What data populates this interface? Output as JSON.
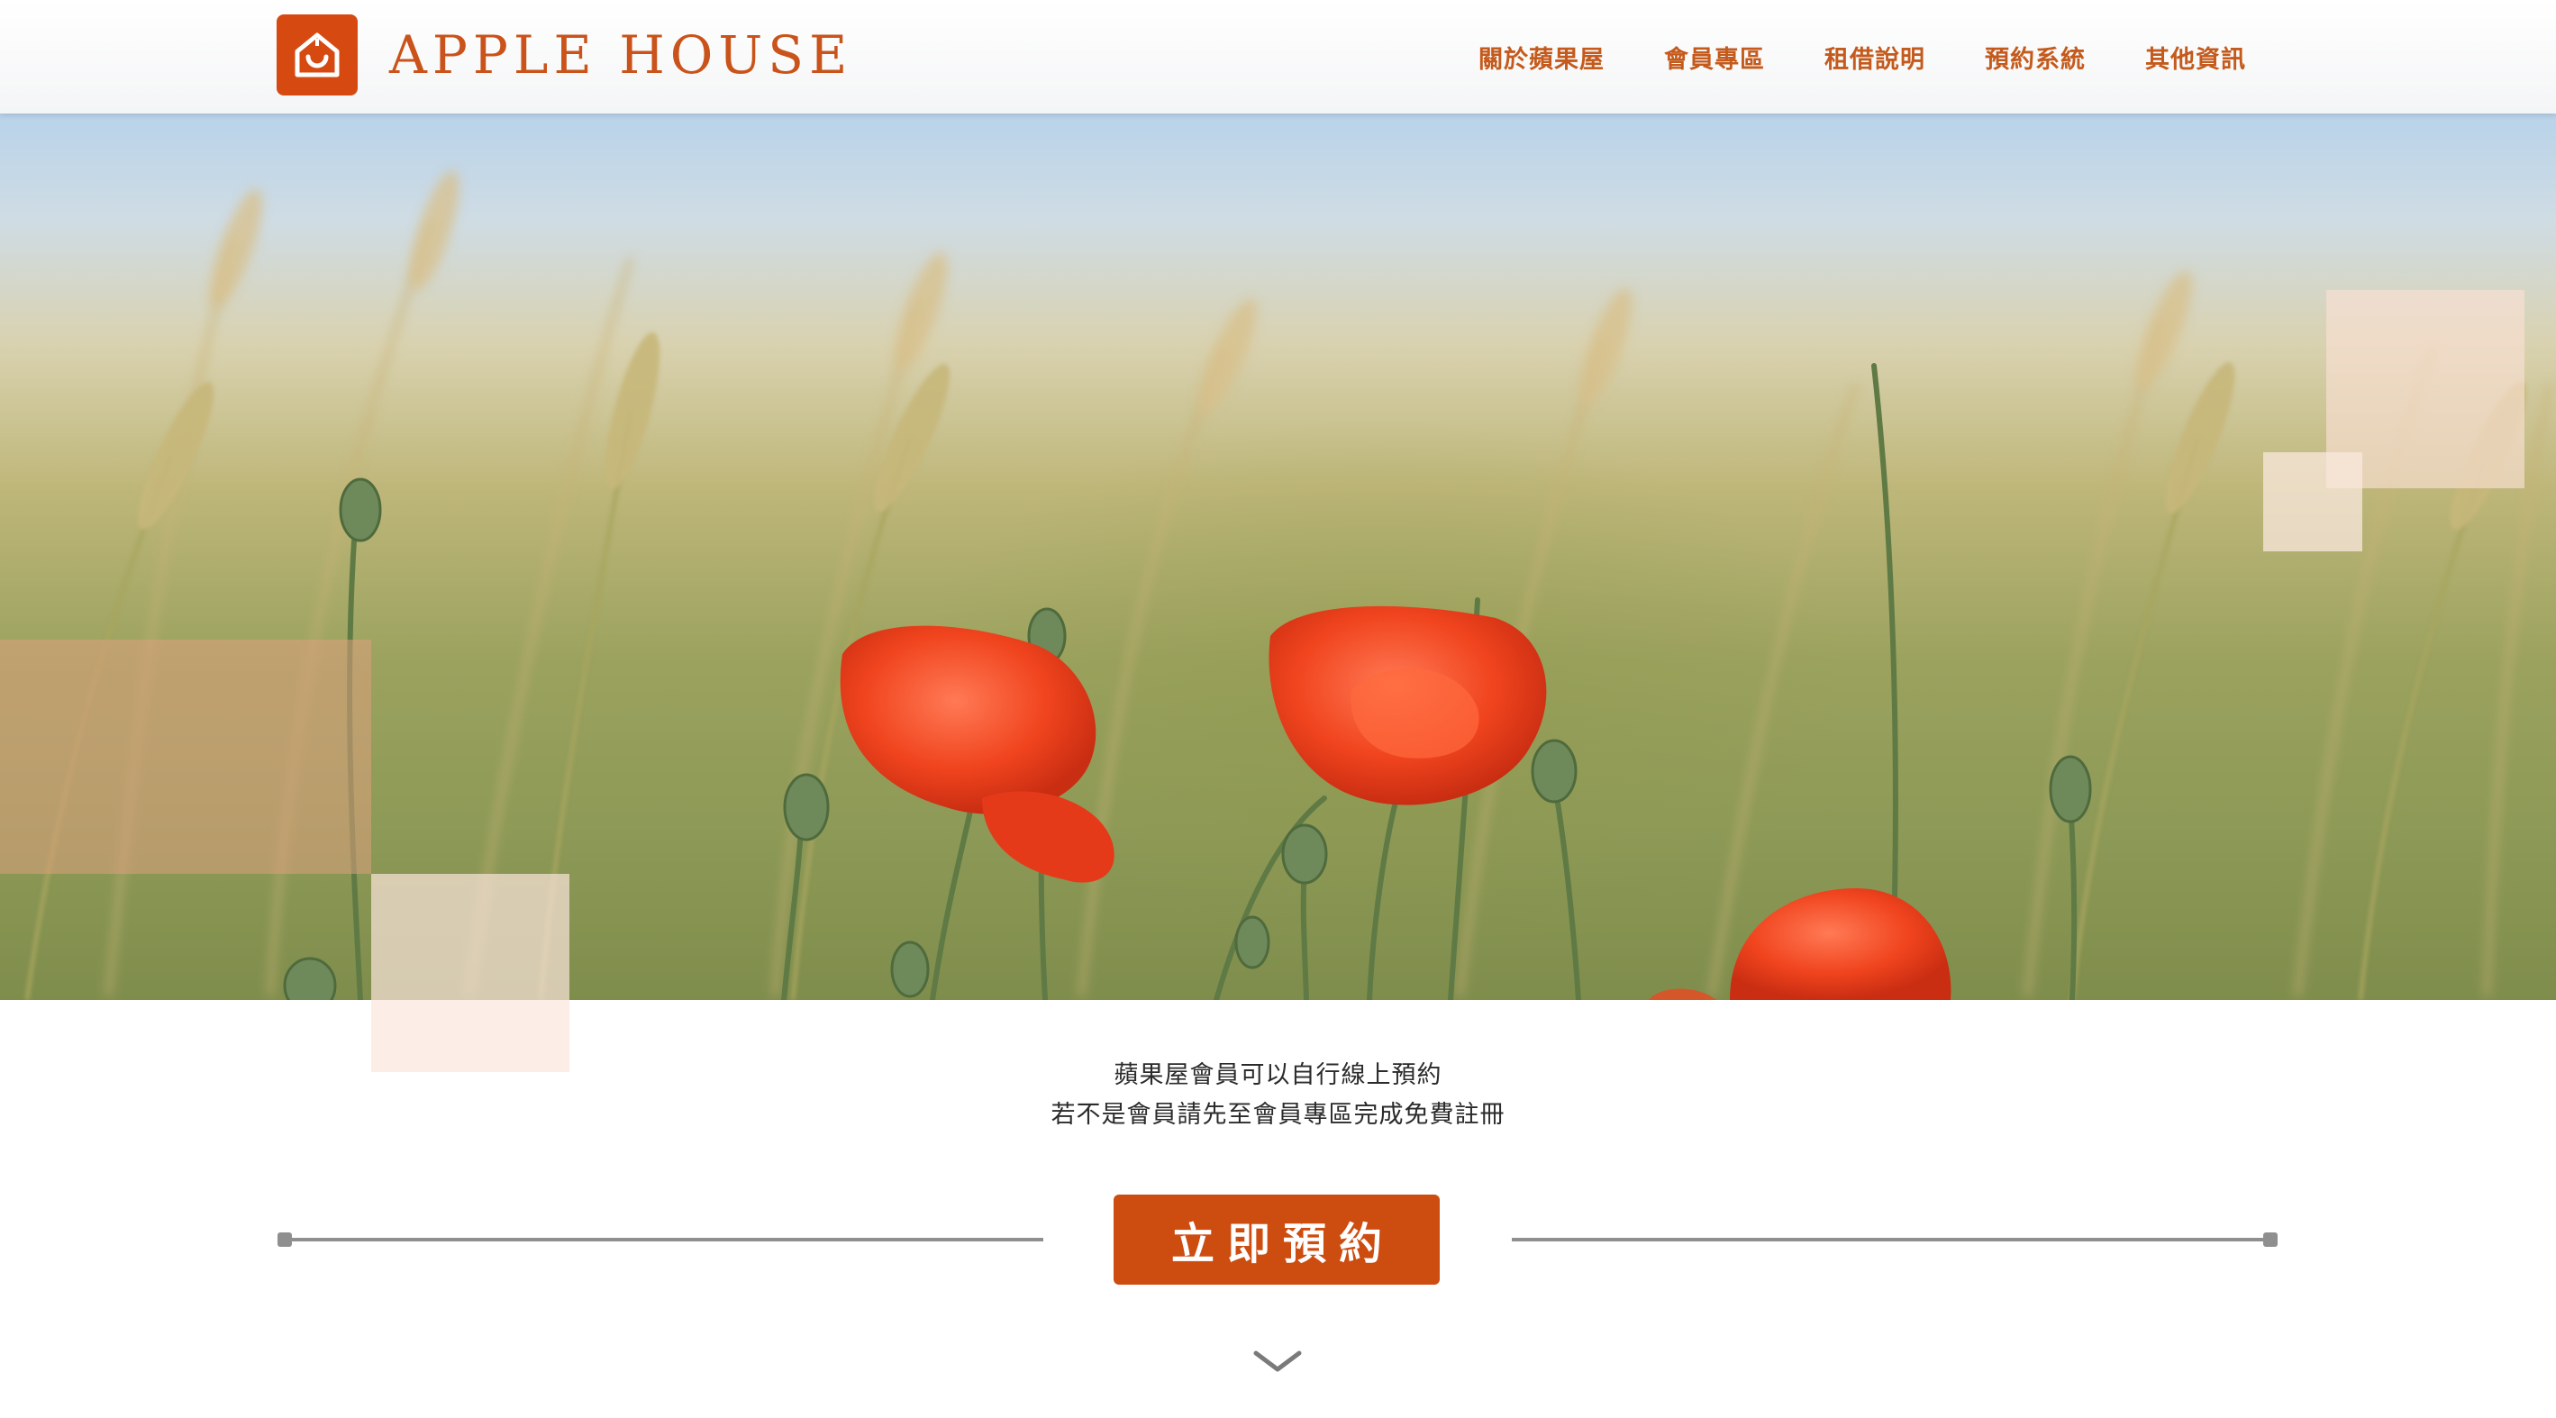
{
  "brand": {
    "name": "APPLE HOUSE",
    "logo_icon": "house-icon",
    "accent": "#d64a12"
  },
  "nav": {
    "items": [
      {
        "label": "關於蘋果屋"
      },
      {
        "label": "會員專區"
      },
      {
        "label": "租借說明"
      },
      {
        "label": "預約系統"
      },
      {
        "label": "其他資訊"
      }
    ]
  },
  "hero": {
    "image": "poppies-in-wheat-field"
  },
  "intro": {
    "line1": "蘋果屋會員可以自行線上預約",
    "line2": "若不是會員請先至會員專區完成免費註冊"
  },
  "cta": {
    "label": "立即預約",
    "color": "#cd4c10"
  },
  "scroll": {
    "icon": "chevron-down-icon"
  }
}
